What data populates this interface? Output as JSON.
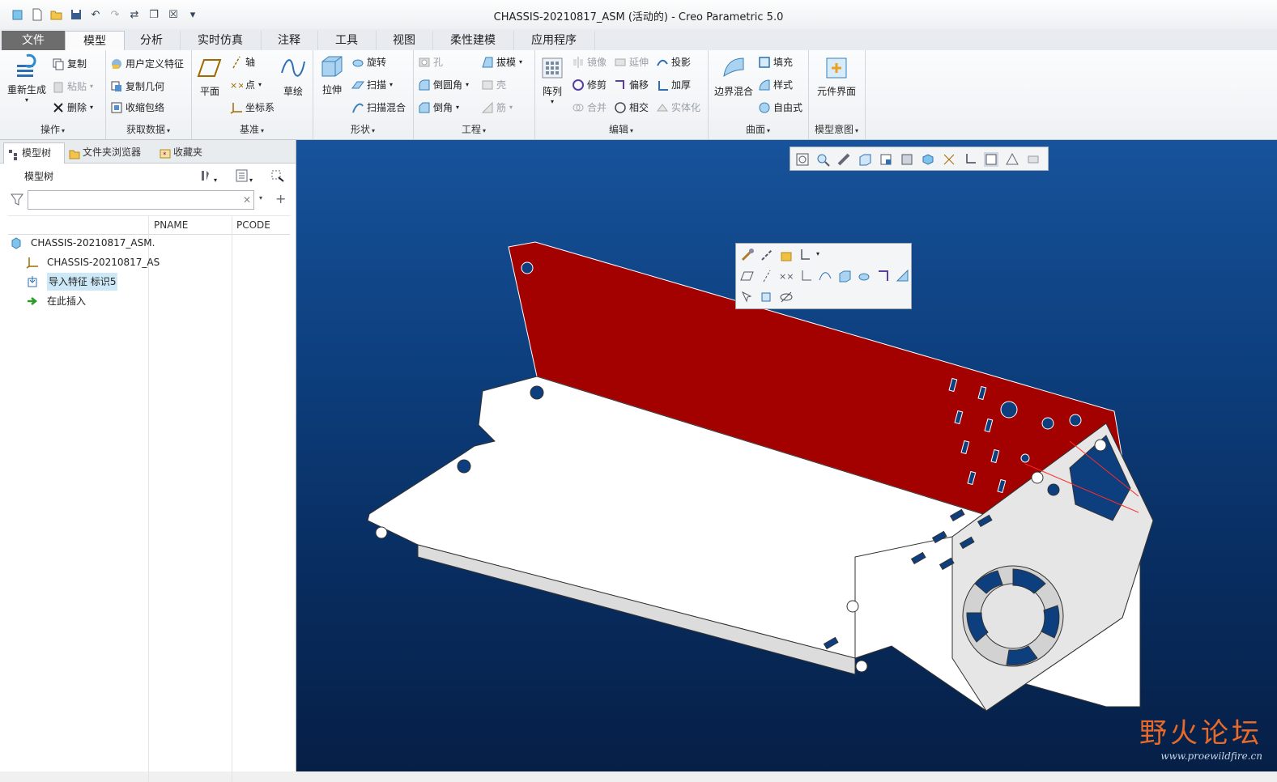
{
  "window": {
    "title": "CHASSIS-20210817_ASM (活动的) - Creo Parametric 5.0"
  },
  "tabs": [
    {
      "label": "文件"
    },
    {
      "label": "模型"
    },
    {
      "label": "分析"
    },
    {
      "label": "实时仿真"
    },
    {
      "label": "注释"
    },
    {
      "label": "工具"
    },
    {
      "label": "视图"
    },
    {
      "label": "柔性建模"
    },
    {
      "label": "应用程序"
    }
  ],
  "ribbon": {
    "operations": {
      "label": "操作",
      "regenerate": "重新生成",
      "copy": "复制",
      "paste": "粘贴",
      "delete": "删除"
    },
    "get_data": {
      "label": "获取数据",
      "udf": "用户定义特征",
      "copy_geom": "复制几何",
      "shrinkwrap": "收缩包络"
    },
    "datum": {
      "label": "基准",
      "plane": "平面",
      "axis": "轴",
      "point": "点",
      "csys": "坐标系",
      "sketch": "草绘"
    },
    "shapes": {
      "label": "形状",
      "extrude": "拉伸",
      "revolve": "旋转",
      "sweep": "扫描",
      "swept_blend": "扫描混合"
    },
    "engineering": {
      "label": "工程",
      "hole": "孔",
      "draft": "拔模",
      "round": "倒圆角",
      "shell": "壳",
      "chamfer": "倒角",
      "rib": "筋"
    },
    "editing": {
      "label": "编辑",
      "pattern": "阵列",
      "mirror": "镜像",
      "extend": "延伸",
      "project": "投影",
      "trim": "修剪",
      "offset": "偏移",
      "thicken": "加厚",
      "merge": "合并",
      "intersect": "相交",
      "solidify": "实体化"
    },
    "surfaces": {
      "label": "曲面",
      "boundary_blend": "边界混合",
      "fill": "填充",
      "style": "样式",
      "freestyle": "自由式"
    },
    "model_intent": {
      "label": "模型意图",
      "component_interface": "元件界面"
    }
  },
  "left_panel": {
    "tabs": [
      {
        "label": "模型树"
      },
      {
        "label": "文件夹浏览器"
      },
      {
        "label": "收藏夹"
      }
    ],
    "tree_title": "模型树",
    "search_value": "",
    "columns": [
      "PNAME",
      "PCODE"
    ],
    "tree": [
      {
        "label": "CHASSIS-20210817_ASM.",
        "icon": "assembly-icon"
      },
      {
        "label": "CHASSIS-20210817_AS",
        "icon": "csys-icon"
      },
      {
        "label": "导入特征 标识5",
        "icon": "import-feature-icon"
      },
      {
        "label": "在此插入",
        "icon": "insert-here-icon"
      }
    ]
  },
  "viewport": {
    "background": "#0d3f7e",
    "model_red": "#a30000"
  },
  "watermark": {
    "title": "野火论坛",
    "url": "www.proewildfire.cn"
  }
}
